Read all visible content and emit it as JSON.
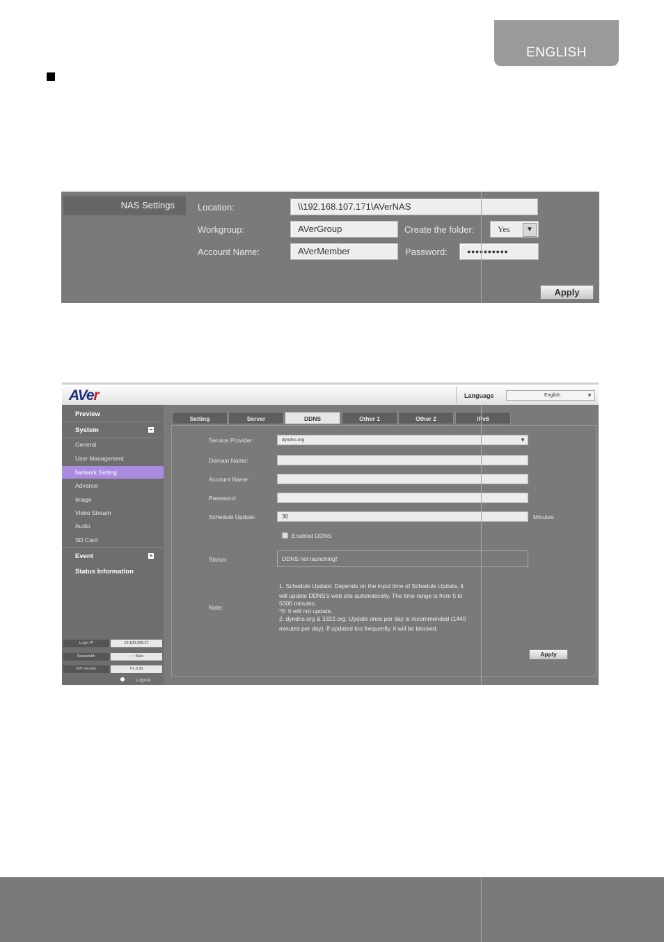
{
  "header": {
    "language_tab": "ENGLISH"
  },
  "nas_panel": {
    "title": "NAS Settings",
    "location_label": "Location:",
    "location_value": "\\\\192.168.107.171\\AVerNAS",
    "workgroup_label": "Workgroup:",
    "workgroup_value": "AVerGroup",
    "create_folder_label": "Create the folder:",
    "create_folder_value": "Yes",
    "account_label": "Account Name:",
    "account_value": "AVerMember",
    "password_label": "Password:",
    "password_value": "●●●●●●●●●●",
    "apply": "Apply"
  },
  "web_ui": {
    "logo": {
      "main": "AVe",
      "accent": "r"
    },
    "language_label": "Language",
    "language_value": "English",
    "sidebar": {
      "preview": "Preview",
      "system": "System",
      "system_toggle": "−",
      "items": [
        "General",
        "User Management",
        "Network Setting",
        "Advance",
        "Image",
        "Video Stream",
        "Audio",
        "SD Card"
      ],
      "event": "Event",
      "event_toggle": "+",
      "status": "Status Information",
      "login_ip_label": "Login IP",
      "login_ip_value": "10.100.200.27",
      "bandwidth_label": "Bandwidth",
      "bandwidth_value": "---- Kb/s",
      "fw_label": "FW Version",
      "fw_value": "V1.0.30",
      "logout": "Logout"
    },
    "tabs": [
      "Setting",
      "Server",
      "DDNS",
      "Other 1",
      "Other 2",
      "IPv6"
    ],
    "form": {
      "provider_label": "Service Provider:",
      "provider_value": "dyndns.org",
      "domain_label": "Domain Name:",
      "account_label": "Account Name:",
      "password_label": "Password:",
      "schedule_label": "Schedule Update:",
      "schedule_value": "30",
      "minutes": "Minutes",
      "enabled_label": "Enabled DDNS",
      "status_label": "Status:",
      "status_value": "DDNS not launching!",
      "note_label": "Note:",
      "note_lines": [
        "1. Schedule Update: Depends on the input time of Schedule Update, it",
        "will update DDNS's web site automatically. The time range is from 5 to",
        "5000 minutes.",
        "*0: It will not update.",
        "2. dyndns.org & 3322.org: Update once per day is recommended (1440",
        "minutes per day). If updated too frequently, it will be blocked."
      ],
      "apply": "Apply"
    }
  },
  "colors": {
    "panel_gray": "#7a7a7a",
    "active_nav": "#a98be0"
  }
}
